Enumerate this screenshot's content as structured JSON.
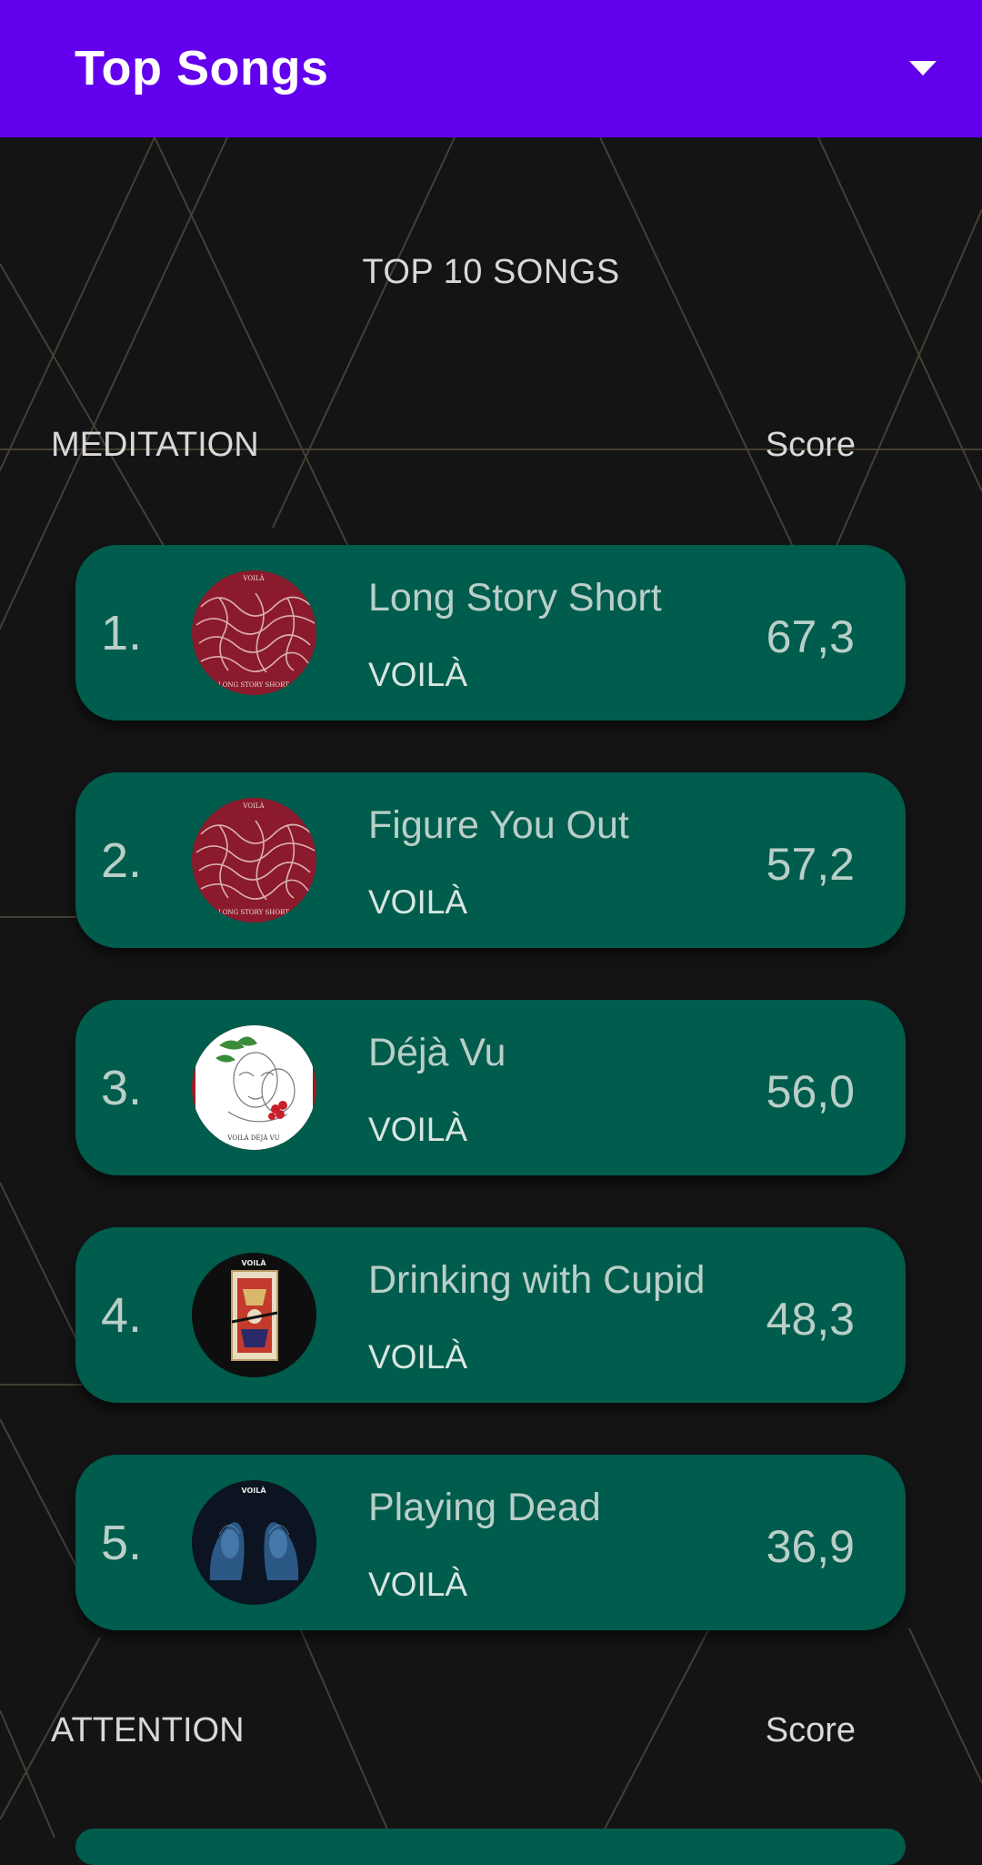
{
  "app_bar": {
    "title": "Top Songs",
    "menu_icon": "chevron-down-icon"
  },
  "heading": "TOP 10 SONGS",
  "sections": [
    {
      "title": "MEDITATION",
      "score_label": "Score",
      "songs": [
        {
          "rank": "1.",
          "title": "Long Story Short",
          "artist": "VOILÀ",
          "score": "67,3",
          "art": "red-pattern-cover"
        },
        {
          "rank": "2.",
          "title": "Figure You Out",
          "artist": "VOILÀ",
          "score": "57,2",
          "art": "red-pattern-cover"
        },
        {
          "rank": "3.",
          "title": "Déjà Vu",
          "artist": "VOILÀ",
          "score": "56,0",
          "art": "white-sketch-cover"
        },
        {
          "rank": "4.",
          "title": "Drinking with Cupid",
          "artist": "VOILÀ",
          "score": "48,3",
          "art": "playing-card-cover"
        },
        {
          "rank": "5.",
          "title": "Playing Dead",
          "artist": "VOILÀ",
          "score": "36,9",
          "art": "blue-hands-cover"
        }
      ]
    },
    {
      "title": "ATTENTION",
      "score_label": "Score"
    }
  ],
  "colors": {
    "app_bar": "#6200EE",
    "card": "#005c4c",
    "background": "#141414"
  }
}
